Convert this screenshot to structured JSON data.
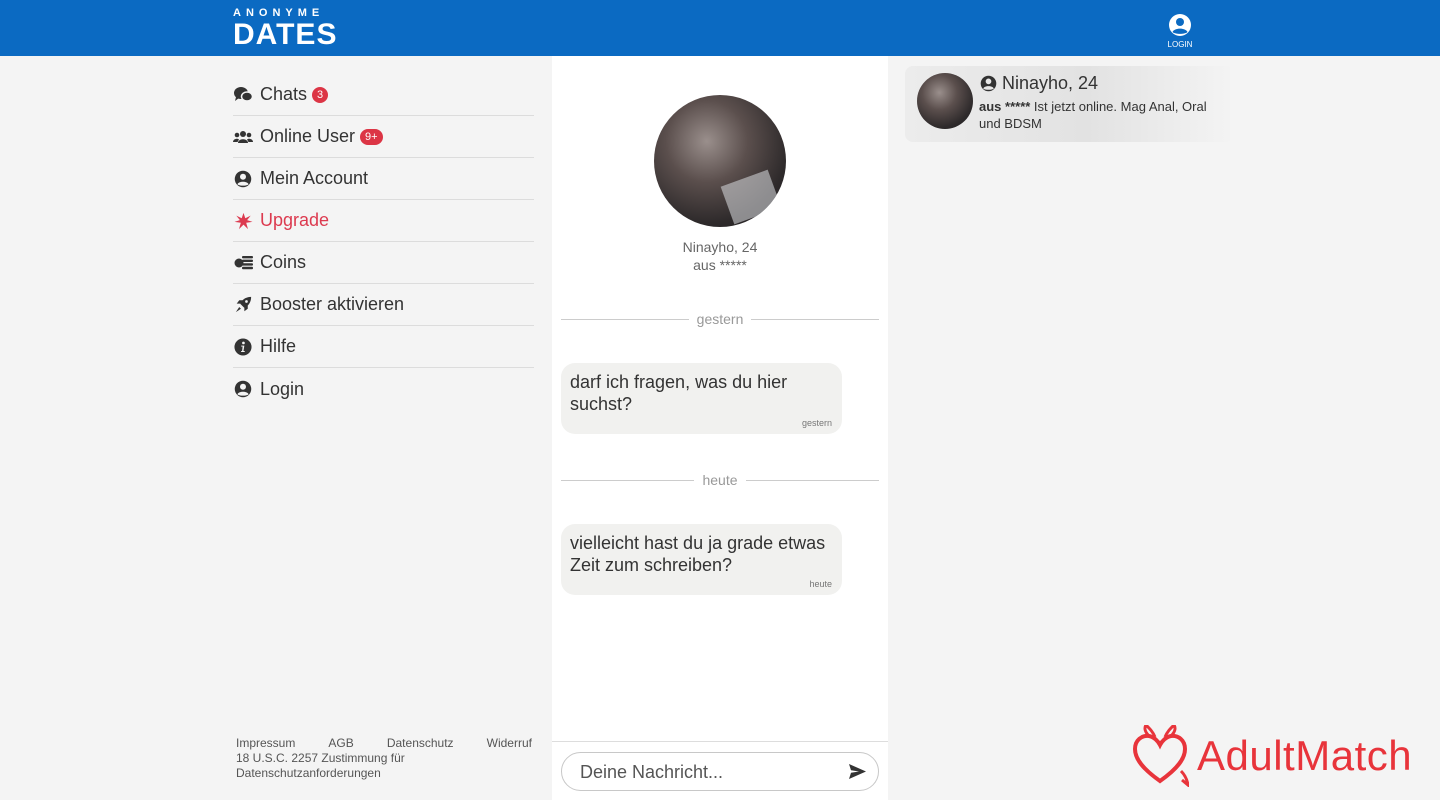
{
  "header": {
    "logo_top": "ANONYME",
    "logo_main": "DATES",
    "login_label": "LOGIN"
  },
  "sidebar": {
    "items": [
      {
        "label": "Chats",
        "icon": "chat-bubbles-icon",
        "badge": "3"
      },
      {
        "label": "Online User",
        "icon": "users-icon",
        "badge": "9+"
      },
      {
        "label": "Mein Account",
        "icon": "user-circle-icon"
      },
      {
        "label": "Upgrade",
        "icon": "burst-icon"
      },
      {
        "label": "Coins",
        "icon": "coins-icon"
      },
      {
        "label": "Booster aktivieren",
        "icon": "rocket-icon"
      },
      {
        "label": "Hilfe",
        "icon": "info-icon"
      },
      {
        "label": "Login",
        "icon": "user-circle-icon"
      }
    ],
    "accent_color": "#dc3a4f"
  },
  "footer": {
    "links": [
      "Impressum",
      "AGB",
      "Datenschutz",
      "Widerruf"
    ],
    "note": "18 U.S.C. 2257 Zustimmung für Datenschutzanforderungen"
  },
  "chat": {
    "profile_name": "Ninayho, 24",
    "profile_location": "aus *****",
    "dividers": [
      "gestern",
      "heute"
    ],
    "messages": [
      {
        "text": "darf ich fragen, was du hier suchst?",
        "time": "gestern"
      },
      {
        "text": "vielleicht hast du ja grade etwas Zeit zum schreiben?",
        "time": "heute"
      }
    ],
    "input_placeholder": "Deine Nachricht..."
  },
  "notification": {
    "name": "Ninayho, 24",
    "location": "aus *****",
    "text": " Ist jetzt online. Mag Anal, Oral und BDSM"
  },
  "watermark": {
    "text": "AdultMatch",
    "color": "#e8343b"
  },
  "colors": {
    "header_bg": "#0b6ac2",
    "badge_bg": "#dc3545"
  }
}
